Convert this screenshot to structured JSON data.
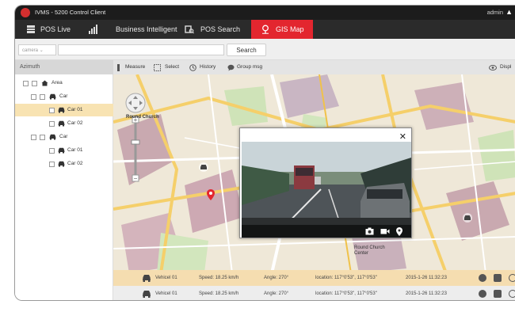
{
  "window": {
    "title": "IVMS - 5200 Control Client",
    "user": "admin"
  },
  "nav": {
    "tabs": [
      {
        "label": "POS Live",
        "icon": "pos-live-icon"
      },
      {
        "label": "Business Intelligent",
        "icon": "bar-chart-icon"
      },
      {
        "label": "POS Search",
        "icon": "pos-search-icon"
      },
      {
        "label": "GIS Map",
        "icon": "map-pin-icon",
        "active": true
      }
    ]
  },
  "search": {
    "select_value": "camera",
    "placeholder": "",
    "button": "Search"
  },
  "sidebar": {
    "header": "Azimuth",
    "tree": [
      {
        "label": "Area",
        "level": 0,
        "icon": "home-icon"
      },
      {
        "label": "Car",
        "level": 1,
        "icon": "car-icon"
      },
      {
        "label": "Car 01",
        "level": 2,
        "icon": "car-icon",
        "selected": true
      },
      {
        "label": "Car 02",
        "level": 2,
        "icon": "car-icon"
      },
      {
        "label": "Car",
        "level": 1,
        "icon": "car-icon"
      },
      {
        "label": "Car 01",
        "level": 2,
        "icon": "car-icon"
      },
      {
        "label": "Car 02",
        "level": 2,
        "icon": "car-icon"
      }
    ]
  },
  "toolbar": {
    "measure": "Measure",
    "select": "Select",
    "history": "History",
    "group_msg": "Group msg",
    "display": "Displ"
  },
  "map": {
    "labels": {
      "church_top": "Round Church",
      "church_bottom": "Round Church Center"
    }
  },
  "vehicles": [
    {
      "name": "Vehicel 01",
      "speed": "Speed: 18.25 km/h",
      "angle": "Angle: 270°",
      "location": "location: 117°0'53\", 117°0'53\"",
      "time": "2015-1-26  11:32:23"
    },
    {
      "name": "Vehicel 01",
      "speed": "Speed: 18.25 km/h",
      "angle": "Angle: 270°",
      "location": "location: 117°0'53\", 117°0'53\"",
      "time": "2015-1-26  11:32:23"
    }
  ],
  "colors": {
    "accent": "#e3262f",
    "selected_row": "#f8e3b2",
    "titlebar": "#1c1c1c",
    "navbar": "#2b2b2b"
  }
}
